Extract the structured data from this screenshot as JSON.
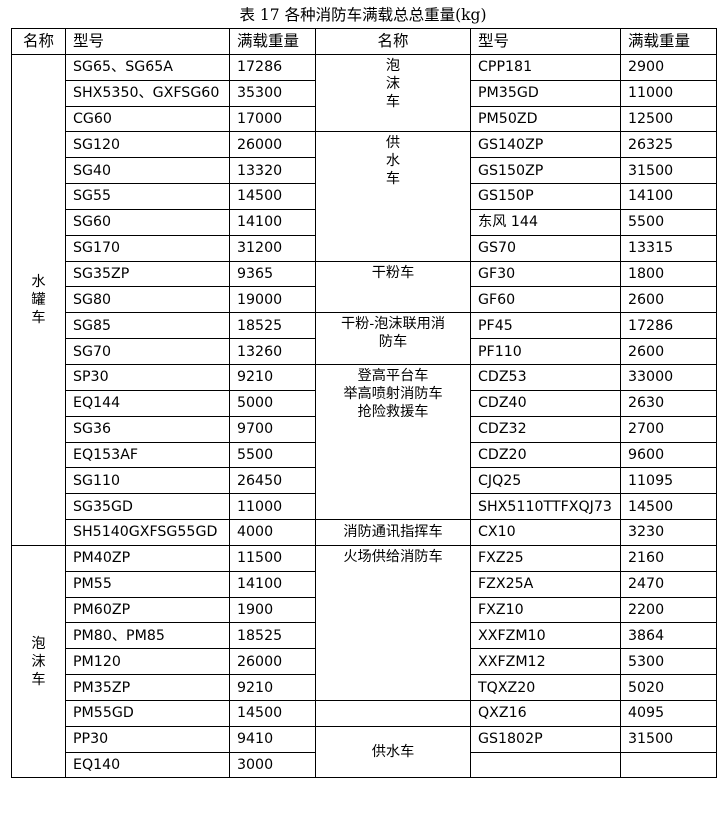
{
  "caption": "表 17  各种消防车满载总总重量(kg)",
  "headers": {
    "left_name": "名称",
    "left_model": "型号",
    "left_weight": "满载重量",
    "right_name": "名称",
    "right_model": "型号",
    "right_weight": "满载重量"
  },
  "left_groups": [
    {
      "name_chars": [
        "水",
        "罐",
        "车"
      ],
      "rows": [
        [
          "SG65、SG65A",
          "17286"
        ],
        [
          "SHX5350、GXFSG60",
          "35300"
        ],
        [
          "CG60",
          "17000"
        ],
        [
          "SG120",
          "26000"
        ],
        [
          "SG40",
          "13320"
        ],
        [
          "SG55",
          "14500"
        ],
        [
          "SG60",
          "14100"
        ],
        [
          "SG170",
          "31200"
        ],
        [
          "SG35ZP",
          "9365"
        ],
        [
          "SG80",
          "19000"
        ],
        [
          "SG85",
          "18525"
        ],
        [
          "SG70",
          "13260"
        ],
        [
          "SP30",
          "9210"
        ],
        [
          "EQ144",
          "5000"
        ],
        [
          "SG36",
          "9700"
        ],
        [
          "EQ153AF",
          "5500"
        ],
        [
          "SG110",
          "26450"
        ],
        [
          "SG35GD",
          "11000"
        ],
        [
          "SH5140GXFSG55GD",
          "4000"
        ]
      ]
    },
    {
      "name_chars": [
        "泡",
        "沫",
        "车"
      ],
      "rows": [
        [
          "PM40ZP",
          "11500"
        ],
        [
          "PM55",
          "14100"
        ],
        [
          "PM60ZP",
          "1900"
        ],
        [
          "PM80、PM85",
          "18525"
        ],
        [
          "PM120",
          "26000"
        ],
        [
          "PM35ZP",
          "9210"
        ],
        [
          "PM55GD",
          "14500"
        ],
        [
          "PP30",
          "9410"
        ],
        [
          "EQ140",
          "3000"
        ]
      ]
    }
  ],
  "right_groups": [
    {
      "name_lines": [
        "泡",
        "沫",
        "车"
      ],
      "rows": [
        [
          "CPP181",
          "2900"
        ],
        [
          "PM35GD",
          "11000"
        ],
        [
          "PM50ZD",
          "12500"
        ]
      ]
    },
    {
      "name_lines": [
        "供",
        "水",
        "车"
      ],
      "rows": [
        [
          "GS140ZP",
          "26325"
        ],
        [
          "GS150ZP",
          "31500"
        ],
        [
          "GS150P",
          "14100"
        ],
        [
          "东风 144",
          "5500"
        ],
        [
          "GS70",
          "13315"
        ]
      ]
    },
    {
      "name_lines": [
        "干粉车"
      ],
      "rows": [
        [
          "GF30",
          "1800"
        ],
        [
          "GF60",
          "2600"
        ]
      ]
    },
    {
      "name_lines": [
        "干粉-泡沫联用消",
        "防车"
      ],
      "rows": [
        [
          "PF45",
          "17286"
        ],
        [
          "PF110",
          "2600"
        ]
      ]
    },
    {
      "name_lines": [
        "登高平台车",
        "举高喷射消防车",
        "抢险救援车"
      ],
      "rows": [
        [
          "CDZ53",
          "33000"
        ],
        [
          "CDZ40",
          "2630"
        ],
        [
          "CDZ32",
          "2700"
        ],
        [
          "CDZ20",
          "9600"
        ],
        [
          "CJQ25",
          "11095"
        ],
        [
          "SHX5110TTFXQJ73",
          "14500"
        ]
      ]
    },
    {
      "name_lines": [
        "消防通讯指挥车"
      ],
      "rows": [
        [
          "CX10",
          "3230"
        ]
      ]
    },
    {
      "name_lines": [
        "火场供给消防车"
      ],
      "rows": [
        [
          "FXZ25",
          "2160"
        ],
        [
          "FZX25A",
          "2470"
        ],
        [
          "FXZ10",
          "2200"
        ],
        [
          "XXFZM10",
          "3864"
        ],
        [
          "XXFZM12",
          "5300"
        ],
        [
          "TQXZ20",
          "5020"
        ]
      ]
    },
    {
      "name_lines": [],
      "rows": [
        [
          "QXZ16",
          "4095"
        ]
      ]
    },
    {
      "name_lines": [
        "供水车"
      ],
      "rows": [
        [
          "GS1802P",
          "31500"
        ],
        [
          "",
          ""
        ]
      ]
    }
  ]
}
